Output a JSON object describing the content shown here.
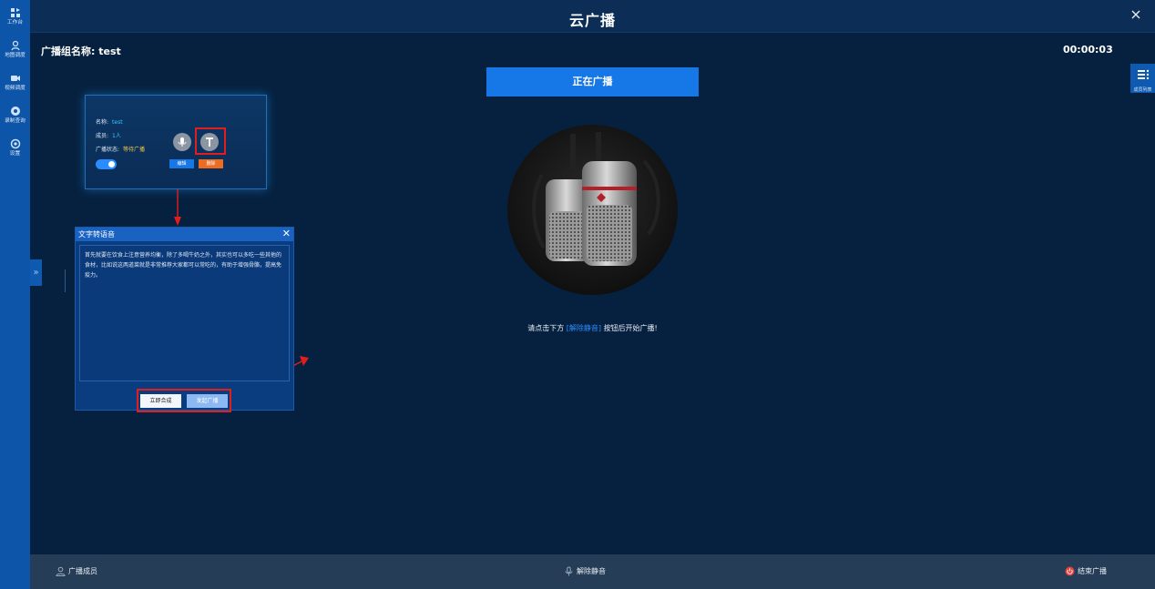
{
  "sidebar": {
    "items": [
      {
        "label": "工作台",
        "icon": "workbench-icon"
      },
      {
        "label": "地图调度",
        "icon": "map-icon"
      },
      {
        "label": "视频调度",
        "icon": "camera-icon"
      },
      {
        "label": "录制查询",
        "icon": "record-icon"
      },
      {
        "label": "设置",
        "icon": "gear-icon"
      }
    ]
  },
  "header": {
    "title": "云广播"
  },
  "broadcast": {
    "group_label": "广播组名称: test",
    "timer": "00:00:03",
    "status_button": "正在广播",
    "hint_prefix": "请点击下方",
    "hint_accent": "[解除静音]",
    "hint_suffix": "按钮后开始广播!"
  },
  "right_tab": {
    "label": "成员列表",
    "icon": "list-icon"
  },
  "card": {
    "name_label": "名称:",
    "name_value": "test",
    "members_label": "成员:",
    "members_value": "1人",
    "status_label": "广播状态:",
    "status_value": "等待广播",
    "edit_label": "编辑",
    "delete_label": "删除",
    "mic_icon": "microphone-icon",
    "text_icon": "text-icon"
  },
  "tts_dialog": {
    "title": "文字转语音",
    "text": "首先就要在饮食上注意营养均衡，除了多喝牛奶之外，其实也可以多吃一些其他的食材，比如说这两道菜就是非常推荐大家都可以常吃的，有助于增强骨骼，提高免疫力。",
    "synthesize_label": "立即合成",
    "send_label": "发起广播"
  },
  "bottom": {
    "members_label": "广播成员",
    "unmute_label": "解除静音",
    "end_label": "结束广播"
  },
  "colors": {
    "accent": "#1677e6",
    "sidebar": "#0d55a8",
    "background": "#06213f",
    "annotation": "#e01e1e",
    "end_red": "#e8413c"
  }
}
